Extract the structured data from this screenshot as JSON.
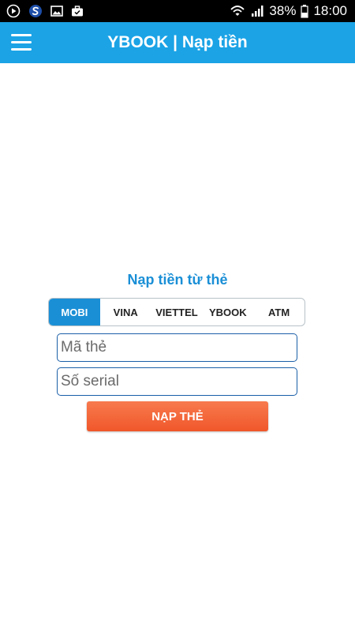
{
  "status_bar": {
    "battery": "38%",
    "time": "18:00",
    "left_icons": [
      "media-icon",
      "s-app-icon",
      "gallery-icon",
      "briefcase-icon"
    ],
    "right_icons": [
      "wifi-icon",
      "signal-icon",
      "battery-icon"
    ]
  },
  "header": {
    "title": "YBOOK | Nạp tiền",
    "menu_icon": "hamburger-menu-icon",
    "color": "#1ba3e6"
  },
  "topup": {
    "title": "Nạp tiền từ thẻ",
    "tabs": [
      {
        "label": "MOBI",
        "selected": true
      },
      {
        "label": "VINA",
        "selected": false
      },
      {
        "label": "VIETTEL",
        "selected": false
      },
      {
        "label": "YBOOK",
        "selected": false
      },
      {
        "label": "ATM",
        "selected": false
      }
    ],
    "card_code_placeholder": "Mã thẻ",
    "serial_placeholder": "Số serial",
    "submit_label": "NẠP THẺ",
    "accent_color": "#1a8fd6",
    "button_color": "#f0572a"
  }
}
